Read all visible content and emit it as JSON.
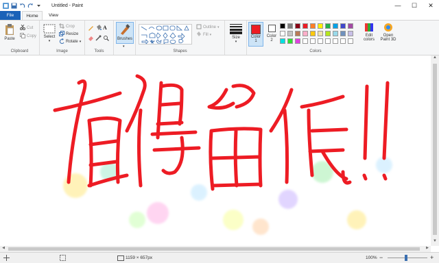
{
  "window": {
    "title": "Untitled - Paint"
  },
  "tabs": {
    "file": "File",
    "home": "Home",
    "view": "View"
  },
  "clipboard": {
    "paste": "Paste",
    "cut": "Cut",
    "copy": "Copy",
    "label": "Clipboard"
  },
  "image": {
    "select": "Select",
    "crop": "Crop",
    "resize": "Resize",
    "rotate": "Rotate",
    "label": "Image"
  },
  "tools": {
    "label": "Tools"
  },
  "brushes": {
    "label": "Brushes"
  },
  "shapes": {
    "outline": "Outline",
    "fill": "Fill",
    "label": "Shapes"
  },
  "size": {
    "label": "Size"
  },
  "colors": {
    "color1": "Color 1",
    "color2": "Color 2",
    "edit": "Edit colors",
    "paint3d": "Open Paint 3D",
    "label": "Colors",
    "palette": [
      "#000000",
      "#7f7f7f",
      "#880015",
      "#ed1c24",
      "#ff7f27",
      "#fff200",
      "#22b14c",
      "#00a2e8",
      "#3f48cc",
      "#a349a4",
      "#ffffff",
      "#c3c3c3",
      "#b97a57",
      "#ffaec9",
      "#ffc90e",
      "#efe4b0",
      "#b5e61d",
      "#99d9ea",
      "#7092be",
      "#c8bfe7",
      "#00e0e0",
      "#30e030",
      "#e040e0",
      "#ffffff",
      "#ffffff",
      "#ffffff",
      "#ffffff",
      "#ffffff",
      "#ffffff",
      "#ffffff"
    ],
    "primary": "#ed1c24",
    "secondary": "#ffffff"
  },
  "canvas": {
    "text": "有得留低!!",
    "ink": "#ed1c24"
  },
  "status": {
    "dimensions": "1159 × 657px",
    "zoom": "100%"
  }
}
